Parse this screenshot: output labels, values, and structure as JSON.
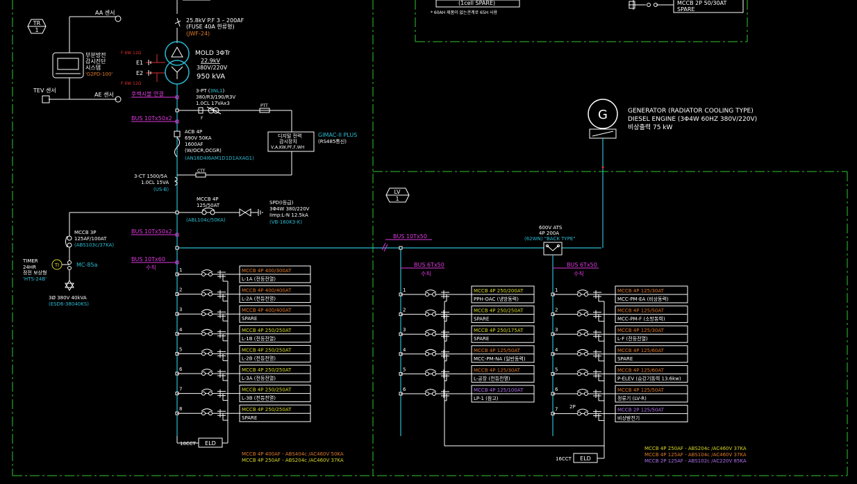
{
  "top_frame": {
    "fragment_1": "(1cell SPARE)",
    "fragment_2": "* 60AH 제품이 없는관계로 65H 사용",
    "fragment_3": "MCCB 2P 50/30AT",
    "fragment_4": "SPARE"
  },
  "tr": {
    "tag": "TR",
    "num": "1",
    "aa_sensor": "AA 센서",
    "monitor_title": "부분방전\n감시진단\n시스템",
    "monitor_model": "'G2PD-100'",
    "fw1": "F 6W 12Ω",
    "fw2": "F 6W 12Ω",
    "e1": "E1",
    "e2": "E2",
    "tev_sensor": "TEV 센서",
    "ae_sensor": "AE 센서",
    "fuse_line1": "25.8kV P.F 3 – 200AF",
    "fuse_line2": "(FUSE 40A 한류형)",
    "fuse_model": "(JWF-24)",
    "mold_title": "MOLD 3ΦTr",
    "mold_hv": "22.9kV",
    "mold_lv": "380V/220V",
    "mold_kva": "950 kVA",
    "link_note": "후렉시블 연결",
    "pt_line1": "3-PT (3NL1)",
    "pt_line2": "380/R3/190/R3V",
    "pt_line3": "1.0CL 17VAx3",
    "f_label": "F",
    "ptt_label": "PTT",
    "bus_label_1": "BUS 10Tx50x2",
    "acb_line1": "ACB 4P",
    "acb_line2": "690V 50KA",
    "acb_line3": "1600AF",
    "acb_line4": "(W/OCR,OCGR)",
    "acb_model": "(AN16D4I6AM1D1D1AXAG1)",
    "meter_line1": "디지털 전력",
    "meter_line2": "감시장치",
    "meter_line3": "V,A,KW,PF,F,WH",
    "meter_model": "GIMAC-II PLUS",
    "meter_comm": "(RS485통신)",
    "ct_line1": "3-CT 1500/5A",
    "ct_line2": "1.0CL 15VA",
    "ct_model": "(US-B)",
    "ctt_label": "CTT",
    "spd_mccb_line1": "MCCB 4P",
    "spd_mccb_line2": "125/50AT",
    "spd_mccb_model": "(ABL104c/50KA)",
    "spd_line1": "SPD(I등급)",
    "spd_line2": "3Φ4W 380/220V",
    "spd_line3": "Iimp:L-N 12.5kA",
    "spd_model": "(VB-160K3-K)",
    "mccb3p_line1": "MCCB 3P",
    "mccb3p_line2": "125AF/100AT",
    "mccb3p_model": "(ABS103c/37KA)",
    "bus_label_2": "BUS 10Tx50x2",
    "timer_line1": "TIMER",
    "timer_line2": "24HR",
    "timer_line3": "정전 보상형",
    "timer_model": "'HTS-24B'",
    "ti_label": "TI",
    "mc_label": "MC-85a",
    "tr3_line1": "3Ø 380V 40kVA",
    "tr3_model": "(ESD6-38040KS)",
    "bus_label_3": "BUS 10Tx60",
    "bus_vertical": "수직",
    "cct_count": "10CCT",
    "eld": "ELD",
    "footer_1": "MCCB 4P 400AF - ABS404c /AC460V 50KA",
    "footer_2": "MCCB 4P 250AF - ABS204c /AC460V 37KA",
    "feeders": [
      {
        "num": "1",
        "rating": "MCCB 4P 400/300AT",
        "load": "L-1A (전등전열)",
        "color": "#e07a2a"
      },
      {
        "num": "2",
        "rating": "MCCB 4P 400/400AT",
        "load": "L-2A (전등전열)",
        "color": "#e07a2a"
      },
      {
        "num": "3",
        "rating": "MCCB 4P 400/400AT",
        "load": "SPARE",
        "color": "#e07a2a"
      },
      {
        "num": "4",
        "rating": "MCCB 4P 250/250AT",
        "load": "L-1B (전등전열)",
        "color": "#d8d82a"
      },
      {
        "num": "5",
        "rating": "MCCB 4P 250/250AT",
        "load": "L-2B (전등전열)",
        "color": "#d8d82a"
      },
      {
        "num": "6",
        "rating": "MCCB 4P 250/250AT",
        "load": "L-3A (전등전열)",
        "color": "#d8d82a"
      },
      {
        "num": "7",
        "rating": "MCCB 4P 250/250AT",
        "load": "L-3B (전등전열)",
        "color": "#d8d82a"
      },
      {
        "num": "8",
        "rating": "MCCB 4P 250/250AT",
        "load": "SPARE",
        "color": "#d8d82a"
      }
    ]
  },
  "gen": {
    "g_label": "G",
    "line1": "GENERATOR (RADIATOR COOLING TYPE)",
    "line2": "DIESEL ENGINE (3Φ4W 60HZ 380V/220V)",
    "line3": "비상출력  75 kW"
  },
  "lv": {
    "tag": "LV",
    "num": "1",
    "bus_main": "BUS 10Tx50",
    "ats_line1": "600V ATS",
    "ats_line2": "4P 200A",
    "ats_model": "(62WN) \"BACK TYPE\"",
    "bus_a": "BUS 6Tx50",
    "bus_a_vertical": "수직",
    "bus_b": "BUS 6Tx50",
    "bus_b_vertical": "수직",
    "twop": "2P",
    "cct_count": "16CCT",
    "eld": "ELD",
    "footer_1": "MCCB 4P 250AF - ABS204c /AC460V 37KA",
    "footer_2": "MCCB 4P 125AF - ABS104c /AC460V 37KA",
    "footer_3": "MCCB 2P 125AF - ABS102c /AC220V 85KA",
    "feeders_a": [
      {
        "num": "1",
        "rating": "MCCB 4P 250/200AT",
        "load": "PPH-OAC (냉방동력)",
        "color": "#d8d82a"
      },
      {
        "num": "2",
        "rating": "MCCB 4P 250/250AT",
        "load": "SPARE",
        "color": "#d8d82a"
      },
      {
        "num": "3",
        "rating": "MCCB 4P 250/175AT",
        "load": "SPARE",
        "color": "#d8d82a"
      },
      {
        "num": "4",
        "rating": "MCCB 4P 125/50AT",
        "load": "MCC-PM-NA (일반동력)",
        "color": "#e07a2a"
      },
      {
        "num": "5",
        "rating": "MCCB 4P 125/30AT",
        "load": "L-공장 (전등전열)",
        "color": "#e07a2a"
      },
      {
        "num": "6",
        "rating": "MCCB 4P 125/100AT",
        "load": "LP-1 (참고)",
        "color": "#b070f0"
      }
    ],
    "feeders_b": [
      {
        "num": "1",
        "rating": "MCCB 4P 125/30AT",
        "load": "MCC-PM-EA (비상동력)",
        "color": "#e07a2a"
      },
      {
        "num": "2",
        "rating": "MCCB 4P 125/50AT",
        "load": "MCC-PM-F (소방동력)",
        "color": "#e07a2a"
      },
      {
        "num": "3",
        "rating": "MCCB 4P 125/30AT",
        "load": "L-F (전등전열)",
        "color": "#e07a2a"
      },
      {
        "num": "4",
        "rating": "MCCB 4P 125/60AT",
        "load": "SPARE",
        "color": "#e07a2a"
      },
      {
        "num": "5",
        "rating": "MCCB 4P 125/60AT",
        "load": "P-ELEV (승강기동력 13.6kw)",
        "color": "#e07a2a"
      },
      {
        "num": "6",
        "rating": "MCCB 4P 125/50AT",
        "load": "정류기 (LV-R)",
        "color": "#e07a2a"
      },
      {
        "num": "7",
        "rating": "MCCB 2P 125/50AT",
        "load": "비상발전기",
        "color": "#b070f0"
      }
    ]
  }
}
